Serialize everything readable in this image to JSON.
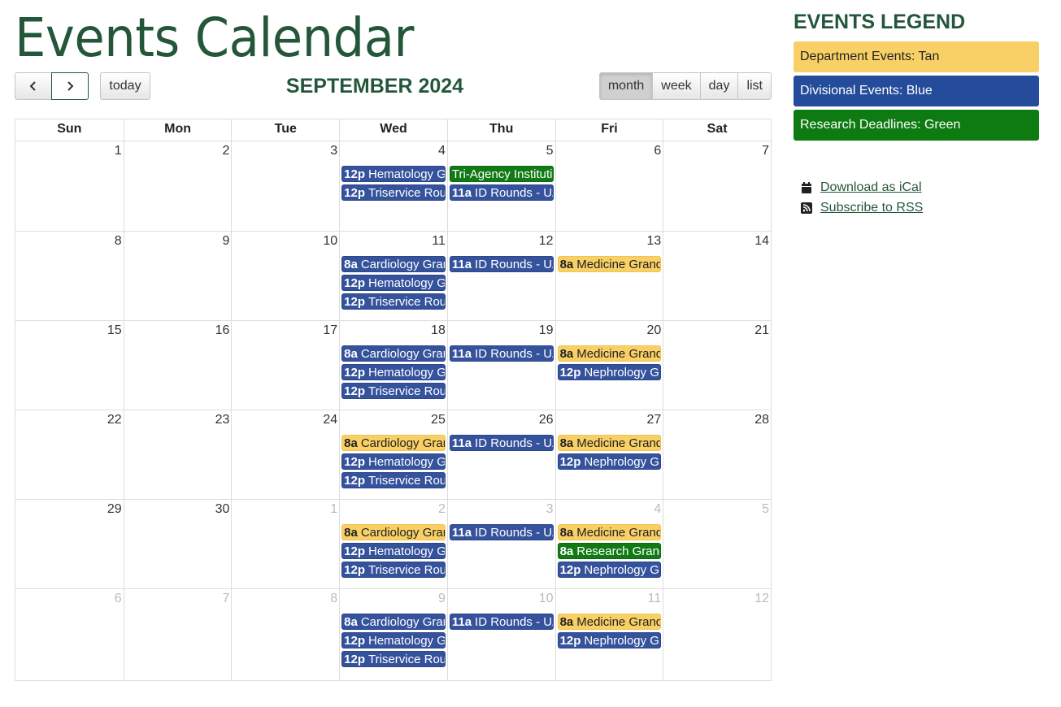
{
  "page": {
    "title": "Events Calendar"
  },
  "toolbar": {
    "prev_icon": "chevron-left-icon",
    "next_icon": "chevron-right-icon",
    "today_label": "today",
    "month_title": "SEPTEMBER 2024",
    "views": [
      "month",
      "week",
      "day",
      "list"
    ],
    "active_view": "month"
  },
  "calendar": {
    "weekdays": [
      "Sun",
      "Mon",
      "Tue",
      "Wed",
      "Thu",
      "Fri",
      "Sat"
    ],
    "weeks": [
      {
        "days": [
          {
            "num": "1",
            "other": false,
            "events": []
          },
          {
            "num": "2",
            "other": false,
            "events": []
          },
          {
            "num": "3",
            "other": false,
            "events": []
          },
          {
            "num": "4",
            "other": false,
            "events": [
              {
                "time": "12p",
                "title": "Hematology Grand Rounds",
                "color": "blue"
              },
              {
                "time": "12p",
                "title": "Triservice Rounds",
                "color": "blue"
              }
            ]
          },
          {
            "num": "5",
            "other": false,
            "events": [
              {
                "time": "",
                "title": "Tri-Agency Institutional Deadline",
                "color": "green"
              },
              {
                "time": "11a",
                "title": "ID Rounds - UAB",
                "color": "blue"
              }
            ]
          },
          {
            "num": "6",
            "other": false,
            "events": []
          },
          {
            "num": "7",
            "other": false,
            "events": []
          }
        ]
      },
      {
        "days": [
          {
            "num": "8",
            "other": false,
            "events": []
          },
          {
            "num": "9",
            "other": false,
            "events": []
          },
          {
            "num": "10",
            "other": false,
            "events": []
          },
          {
            "num": "11",
            "other": false,
            "events": [
              {
                "time": "8a",
                "title": "Cardiology Grand Rounds",
                "color": "blue"
              },
              {
                "time": "12p",
                "title": "Hematology Grand Rounds",
                "color": "blue"
              },
              {
                "time": "12p",
                "title": "Triservice Rounds",
                "color": "blue"
              }
            ]
          },
          {
            "num": "12",
            "other": false,
            "events": [
              {
                "time": "11a",
                "title": "ID Rounds - UAB",
                "color": "blue"
              }
            ]
          },
          {
            "num": "13",
            "other": false,
            "events": [
              {
                "time": "8a",
                "title": "Medicine Grand Rounds",
                "color": "tan"
              }
            ]
          },
          {
            "num": "14",
            "other": false,
            "events": []
          }
        ]
      },
      {
        "days": [
          {
            "num": "15",
            "other": false,
            "events": []
          },
          {
            "num": "16",
            "other": false,
            "events": []
          },
          {
            "num": "17",
            "other": false,
            "events": []
          },
          {
            "num": "18",
            "other": false,
            "events": [
              {
                "time": "8a",
                "title": "Cardiology Grand Rounds",
                "color": "blue"
              },
              {
                "time": "12p",
                "title": "Hematology Grand Rounds",
                "color": "blue"
              },
              {
                "time": "12p",
                "title": "Triservice Rounds",
                "color": "blue"
              }
            ]
          },
          {
            "num": "19",
            "other": false,
            "events": [
              {
                "time": "11a",
                "title": "ID Rounds - UAB",
                "color": "blue"
              }
            ]
          },
          {
            "num": "20",
            "other": false,
            "events": [
              {
                "time": "8a",
                "title": "Medicine Grand Rounds",
                "color": "tan"
              },
              {
                "time": "12p",
                "title": "Nephrology Grand Rounds",
                "color": "blue"
              }
            ]
          },
          {
            "num": "21",
            "other": false,
            "events": []
          }
        ]
      },
      {
        "days": [
          {
            "num": "22",
            "other": false,
            "events": []
          },
          {
            "num": "23",
            "other": false,
            "events": []
          },
          {
            "num": "24",
            "other": false,
            "events": []
          },
          {
            "num": "25",
            "other": false,
            "events": [
              {
                "time": "8a",
                "title": "Cardiology Grand Rounds",
                "color": "tan"
              },
              {
                "time": "12p",
                "title": "Hematology Grand Rounds",
                "color": "blue"
              },
              {
                "time": "12p",
                "title": "Triservice Rounds",
                "color": "blue"
              }
            ]
          },
          {
            "num": "26",
            "other": false,
            "events": [
              {
                "time": "11a",
                "title": "ID Rounds - UAB",
                "color": "blue"
              }
            ]
          },
          {
            "num": "27",
            "other": false,
            "events": [
              {
                "time": "8a",
                "title": "Medicine Grand Rounds",
                "color": "tan"
              },
              {
                "time": "12p",
                "title": "Nephrology Grand Rounds",
                "color": "blue"
              }
            ]
          },
          {
            "num": "28",
            "other": false,
            "events": []
          }
        ]
      },
      {
        "days": [
          {
            "num": "29",
            "other": false,
            "events": []
          },
          {
            "num": "30",
            "other": false,
            "events": []
          },
          {
            "num": "1",
            "other": true,
            "events": []
          },
          {
            "num": "2",
            "other": true,
            "events": [
              {
                "time": "8a",
                "title": "Cardiology Grand Rounds",
                "color": "tan"
              },
              {
                "time": "12p",
                "title": "Hematology Grand Rounds",
                "color": "blue"
              },
              {
                "time": "12p",
                "title": "Triservice Rounds",
                "color": "blue"
              }
            ]
          },
          {
            "num": "3",
            "other": true,
            "events": [
              {
                "time": "11a",
                "title": "ID Rounds - UAB",
                "color": "blue"
              }
            ]
          },
          {
            "num": "4",
            "other": true,
            "events": [
              {
                "time": "8a",
                "title": "Medicine Grand Rounds",
                "color": "tan"
              },
              {
                "time": "8a",
                "title": "Research Grand Rounds",
                "color": "green"
              },
              {
                "time": "12p",
                "title": "Nephrology Grand Rounds",
                "color": "blue"
              }
            ]
          },
          {
            "num": "5",
            "other": true,
            "events": []
          }
        ]
      },
      {
        "days": [
          {
            "num": "6",
            "other": true,
            "events": []
          },
          {
            "num": "7",
            "other": true,
            "events": []
          },
          {
            "num": "8",
            "other": true,
            "events": []
          },
          {
            "num": "9",
            "other": true,
            "events": [
              {
                "time": "8a",
                "title": "Cardiology Grand Rounds",
                "color": "blue"
              },
              {
                "time": "12p",
                "title": "Hematology Grand Rounds",
                "color": "blue"
              },
              {
                "time": "12p",
                "title": "Triservice Rounds",
                "color": "blue"
              }
            ]
          },
          {
            "num": "10",
            "other": true,
            "events": [
              {
                "time": "11a",
                "title": "ID Rounds - UAB",
                "color": "blue"
              }
            ]
          },
          {
            "num": "11",
            "other": true,
            "events": [
              {
                "time": "8a",
                "title": "Medicine Grand Rounds",
                "color": "tan"
              },
              {
                "time": "12p",
                "title": "Nephrology Grand Rounds",
                "color": "blue"
              }
            ]
          },
          {
            "num": "12",
            "other": true,
            "events": []
          }
        ]
      }
    ]
  },
  "legend": {
    "title": "EVENTS LEGEND",
    "items": [
      {
        "label": "Department Events: Tan",
        "color": "tan"
      },
      {
        "label": "Divisional Events: Blue",
        "color": "blue"
      },
      {
        "label": "Research Deadlines: Green",
        "color": "green"
      }
    ]
  },
  "links": [
    {
      "label": "Download as iCal",
      "icon": "calendar-icon"
    },
    {
      "label": "Subscribe to RSS",
      "icon": "rss-icon"
    }
  ]
}
